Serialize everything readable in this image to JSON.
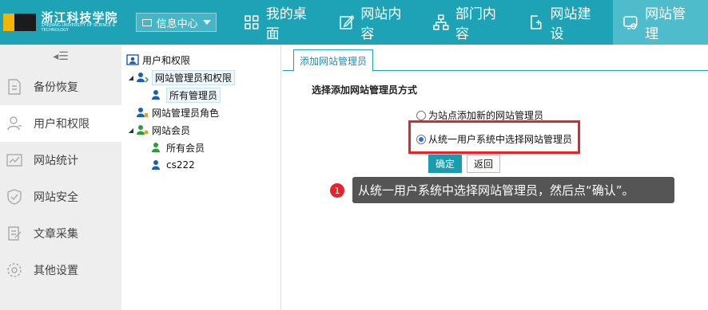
{
  "header": {
    "logo_text": "浙江科技学院",
    "logo_sub": "ZHEJIANG UNIVERSITY OF SCIENCE & TECHNOLOGY",
    "info_center": "信息中心",
    "nav": [
      {
        "label": "我的桌面",
        "icon": "grid-icon"
      },
      {
        "label": "网站内容",
        "icon": "edit-icon"
      },
      {
        "label": "部门内容",
        "icon": "org-chart-icon"
      },
      {
        "label": "网站建设",
        "icon": "add-page-icon"
      },
      {
        "label": "网站管理",
        "icon": "site-settings-icon"
      }
    ]
  },
  "sidebar": {
    "items": [
      {
        "label": "备份恢复",
        "icon": "backup-icon"
      },
      {
        "label": "用户和权限",
        "icon": "user-icon"
      },
      {
        "label": "网站统计",
        "icon": "chart-icon"
      },
      {
        "label": "网站安全",
        "icon": "shield-icon"
      },
      {
        "label": "文章采集",
        "icon": "collect-icon"
      },
      {
        "label": "其他设置",
        "icon": "gear-icon"
      }
    ]
  },
  "tree": {
    "root": "用户和权限",
    "admins_group": "网站管理员和权限",
    "all_admins": "所有管理员",
    "admin_roles": "网站管理员角色",
    "members_group": "网站会员",
    "all_members": "所有会员",
    "user_cs222": "cs222"
  },
  "main": {
    "tab": "添加网站管理员",
    "section_title": "选择添加网站管理员方式",
    "option_new": "为站点添加新的网站管理员",
    "option_unified": "从统一用户系统中选择网站管理员",
    "confirm_label": "确定",
    "back_label": "返回",
    "tip_number": "1",
    "tip_text": "从统一用户系统中选择网站管理员，然后点“确认”。"
  },
  "colors": {
    "brand": "#1ea3b6",
    "highlight": "#e8232a"
  }
}
